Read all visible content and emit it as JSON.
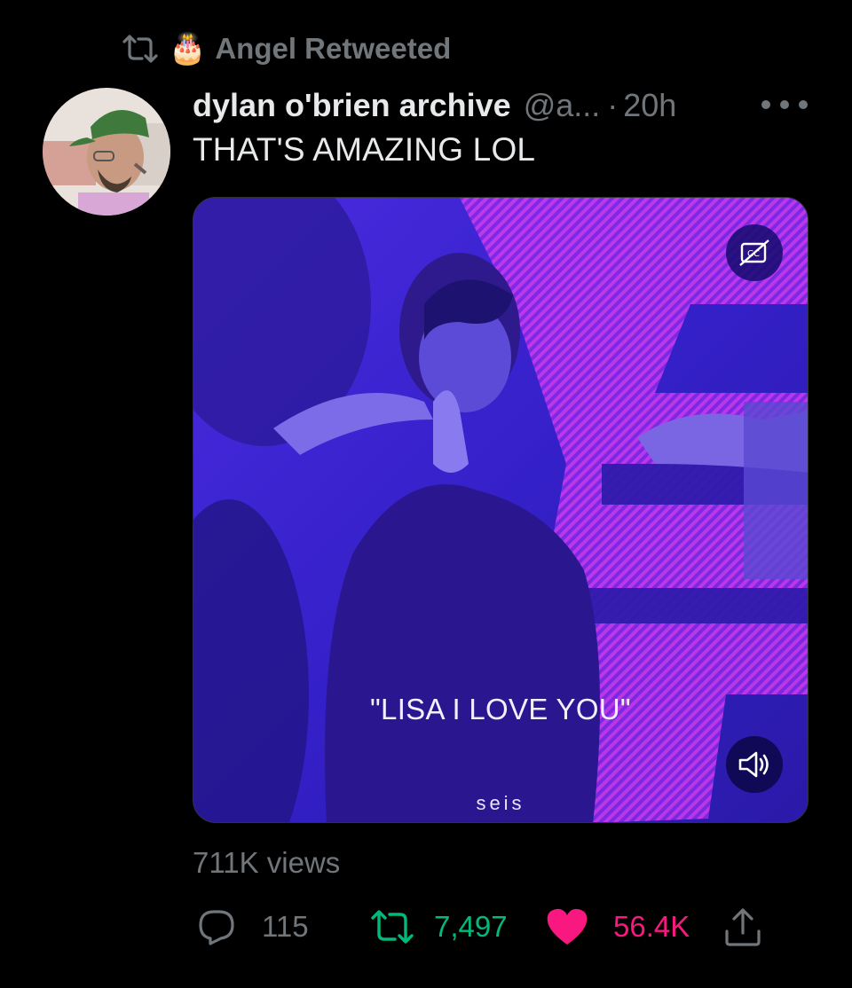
{
  "retweet_context": {
    "icon": "retweet-icon",
    "badge": "🎂",
    "label": "Angel Retweeted"
  },
  "tweet": {
    "display_name": "dylan o'brien archive",
    "handle": "@a...",
    "separator": "·",
    "time": "20h",
    "text": "THAT'S AMAZING LOL"
  },
  "media": {
    "caption": "\"LISA I LOVE YOU\"",
    "watermark": "seis",
    "cc_icon": "captions-off-icon",
    "volume_icon": "volume-icon"
  },
  "stats": {
    "views": "711K views",
    "replies": "115",
    "retweets": "7,497",
    "likes": "56.4K"
  },
  "colors": {
    "background": "#000000",
    "text_primary": "#e7e9ea",
    "text_secondary": "#71767b",
    "retweet_green": "#00ba7c",
    "like_pink": "#f91880"
  }
}
